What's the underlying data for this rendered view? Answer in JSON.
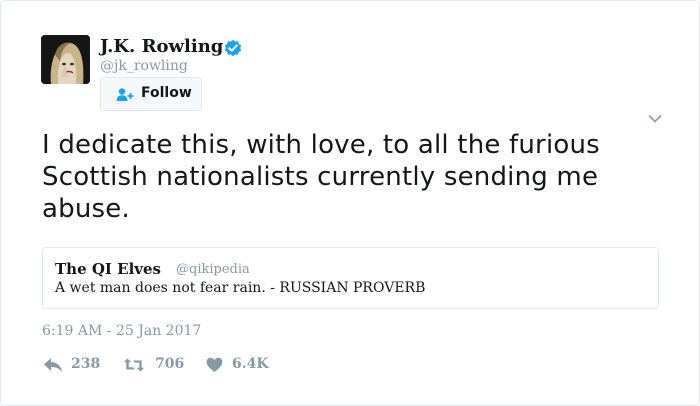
{
  "author": {
    "name": "J.K. Rowling",
    "handle": "@jk_rowling",
    "avatar_icon": "profile-photo",
    "verified": true
  },
  "follow_button": {
    "label": "Follow",
    "icon": "add-user-icon"
  },
  "tweet": {
    "text": "I dedicate this, with love, to all the furious Scottish nationalists currently sending me abuse."
  },
  "quoted_tweet": {
    "name": "The QI Elves",
    "handle": "@qikipedia",
    "text": "A wet man does not fear rain. - RUSSIAN PROVERB"
  },
  "timestamp": "6:19 AM - 25 Jan 2017",
  "actions": {
    "reply": {
      "icon": "reply-icon",
      "count": "238"
    },
    "retweet": {
      "icon": "retweet-icon",
      "count": "706"
    },
    "like": {
      "icon": "heart-icon",
      "count": "6.4K"
    }
  },
  "colors": {
    "text": "#14171a",
    "muted": "#8899a6",
    "border": "#e1e8ed",
    "verified": "#1da1f2",
    "follow_icon": "#1da1f2"
  }
}
